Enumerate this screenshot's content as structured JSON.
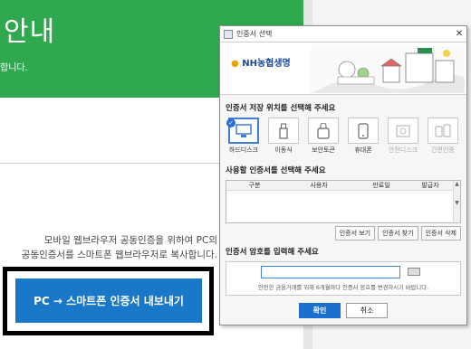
{
  "background": {
    "heading": "안내",
    "subtext": "합니다.",
    "mobile_text_line1": "모바일 웹브라우저 공동인증을 위하여 PC의",
    "mobile_text_line2": "공동인증서를 스마트폰 웹브라우저로 복사합니다.",
    "export_button": "PC → 스마트폰 인증서 내보내기",
    "colors": {
      "green": "#2fa84f",
      "button_blue": "#1a78c8"
    }
  },
  "dialog": {
    "title": "인증서 선택",
    "logo": "NH농협생명",
    "section_location": "인증서 저장 위치를 선택해 주세요",
    "devices": [
      {
        "label": "하드디스크",
        "icon": "monitor-icon",
        "selected": true,
        "disabled": false
      },
      {
        "label": "이동식",
        "icon": "usb-icon",
        "selected": false,
        "disabled": false
      },
      {
        "label": "보안토큰",
        "icon": "token-icon",
        "selected": false,
        "disabled": false
      },
      {
        "label": "휴대폰",
        "icon": "phone-icon",
        "selected": false,
        "disabled": false
      },
      {
        "label": "안전디스크",
        "icon": "safe-disk-icon",
        "selected": false,
        "disabled": true
      },
      {
        "label": "간편인증",
        "icon": "simple-auth-icon",
        "selected": false,
        "disabled": true
      }
    ],
    "section_cert": "사용할 인증서를 선택해 주세요",
    "table_headers": [
      "구분",
      "사용자",
      "만료일",
      "발급자"
    ],
    "cert_buttons": [
      "인증서 보기",
      "인증서 찾기",
      "인증서 삭제"
    ],
    "section_password": "인증서 암호를 입력해 주세요",
    "password_note": "안전한 금융거래를 위해 6개월마다 인증서 암호를 변경하시기 바랍니다.",
    "ok": "확인",
    "cancel": "취소"
  }
}
